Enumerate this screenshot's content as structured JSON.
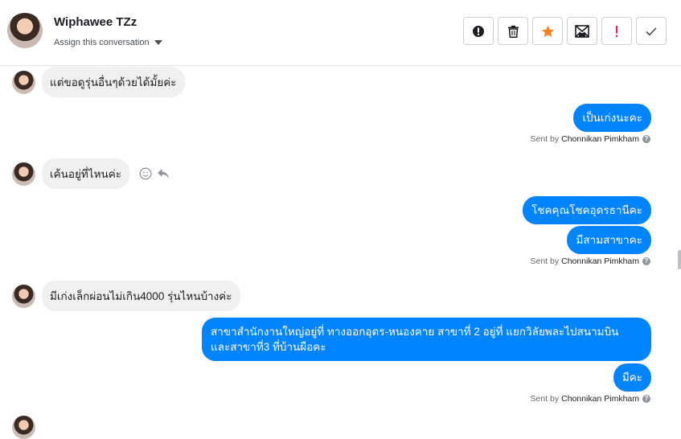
{
  "header": {
    "name": "Wiphawee TZz",
    "assign_label": "Assign this conversation",
    "actions": [
      {
        "icon": "alert-circle-icon"
      },
      {
        "icon": "trash-icon"
      },
      {
        "icon": "star-icon",
        "color": "#f5831f"
      },
      {
        "icon": "mail-icon"
      },
      {
        "icon": "exclamation-icon",
        "color": "#e0245e"
      },
      {
        "icon": "check-icon"
      }
    ]
  },
  "messages": {
    "m1": "แต่ขอดูรุ่นอื่นๆด้วยได้มั้ยค่ะ",
    "m2": "เป็นเก่งนะคะ",
    "m3": "เค้นอยู่ที่ไหนค่ะ",
    "m4": "โชคคุณโชคอุดรธานีคะ",
    "m5": "มีสามสาขาคะ",
    "m6": "มีเก่งเล็กผ่อนไม่เกิน4000 รุ่นไหนบ้างค่ะ",
    "m7_line1": "สาขาสำนักงานใหญ่อยู่ที่ ทางออกอุดร-หนองคาย สาขาที่ 2 อยู่ที่ แยกวิลัยพละไปสนามบิน",
    "m7_line2": "และสาขาที่3 ที่บ้านผือคะ",
    "m8": "มีคะ"
  },
  "sent_by": {
    "prefix": "Sent by",
    "agent": "Chonnikan Pimkham"
  },
  "colors": {
    "outgoing": "#0084ff",
    "incoming": "#f1f0f0"
  }
}
